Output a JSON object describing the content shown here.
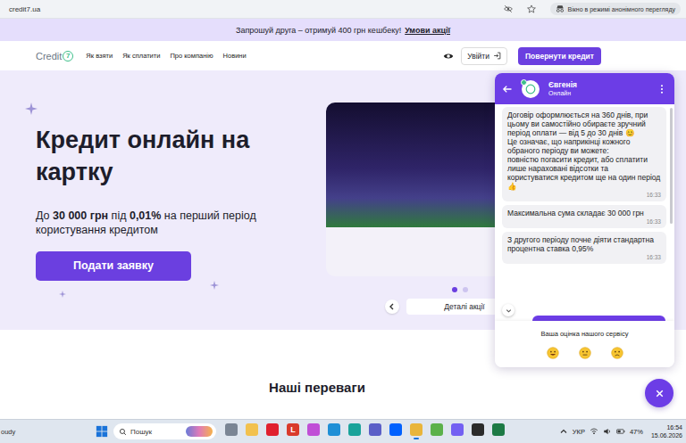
{
  "browser": {
    "url": "credit7.ua",
    "incognito_label": "Вікно в режимі анонімного перегляду"
  },
  "promo_bar": {
    "text": "Запрошуй друга – отримуй 400 грн кешбеку!",
    "link": "Умови акції"
  },
  "nav": {
    "logo_text": "Credit",
    "logo_digit": "7",
    "links": [
      "Як взяти",
      "Як сплатити",
      "Про компанію",
      "Новини"
    ],
    "login": "Увійти",
    "return_button": "Повернути кредит"
  },
  "hero": {
    "title": "Кредит онлайн на картку",
    "subtitle": [
      {
        "text": "До ",
        "bold": false
      },
      {
        "text": "30 000 грн",
        "bold": true
      },
      {
        "text": " під ",
        "bold": false
      },
      {
        "text": "0,01%",
        "bold": true
      },
      {
        "text": " на перший період користування кредитом",
        "bold": false
      }
    ],
    "cta": "Подати заявку",
    "slides": [
      {
        "selected": true
      },
      {
        "selected": false
      }
    ],
    "details_button": "Деталі акції"
  },
  "benefits": {
    "title": "Наші переваги"
  },
  "chat": {
    "agent_name": "Євгенія",
    "status": "Онлайн",
    "messages": [
      {
        "text": "Договір оформлюється на 360 днів, при цьому ви самостійно обираєте зручний період оплати — від 5 до 30 днів 😊\nЦе означає, що наприкінці кожного обраного періоду ви можете:\nповністю погасити кредит, або сплатити лише нараховані відсотки та користуватися кредитом ще на один період 👍",
        "time": "16:33"
      },
      {
        "text": "Максимальна сума складає 30 000 грн",
        "time": "16:33"
      },
      {
        "text": "З другого періоду почне діяти стандартна процентна ставка 0,95%",
        "time": "16:33"
      }
    ],
    "rating_prompt": "Ваша оцінка нашого сервісу",
    "rating_options": [
      {
        "kind": "happy"
      },
      {
        "kind": "neutral"
      },
      {
        "kind": "sad"
      }
    ]
  },
  "taskbar": {
    "weather_text": "oudy",
    "search_placeholder": "Пошук",
    "apps": [
      {
        "color": "#7a8594",
        "active": false
      },
      {
        "color": "#f2c14e",
        "active": false
      },
      {
        "color": "#e0202e",
        "active": false
      },
      {
        "color": "#d93a2b",
        "active": false,
        "glyph": "L"
      },
      {
        "color": "#c04fd6",
        "active": false
      },
      {
        "color": "#1f8fd6",
        "active": false
      },
      {
        "color": "#1aa39a",
        "active": false
      },
      {
        "color": "#5b5fc7",
        "active": false
      },
      {
        "color": "#0061fe",
        "active": false
      },
      {
        "color": "#e9b53a",
        "active": true
      },
      {
        "color": "#5bb14a",
        "active": false
      },
      {
        "color": "#7360f2",
        "active": false
      },
      {
        "color": "#2b2b2b",
        "active": false
      },
      {
        "color": "#1d7a45",
        "active": false
      }
    ],
    "tray": {
      "language": "УКР",
      "battery": "47%",
      "time": "16:54",
      "date": "15.06.2026"
    }
  }
}
